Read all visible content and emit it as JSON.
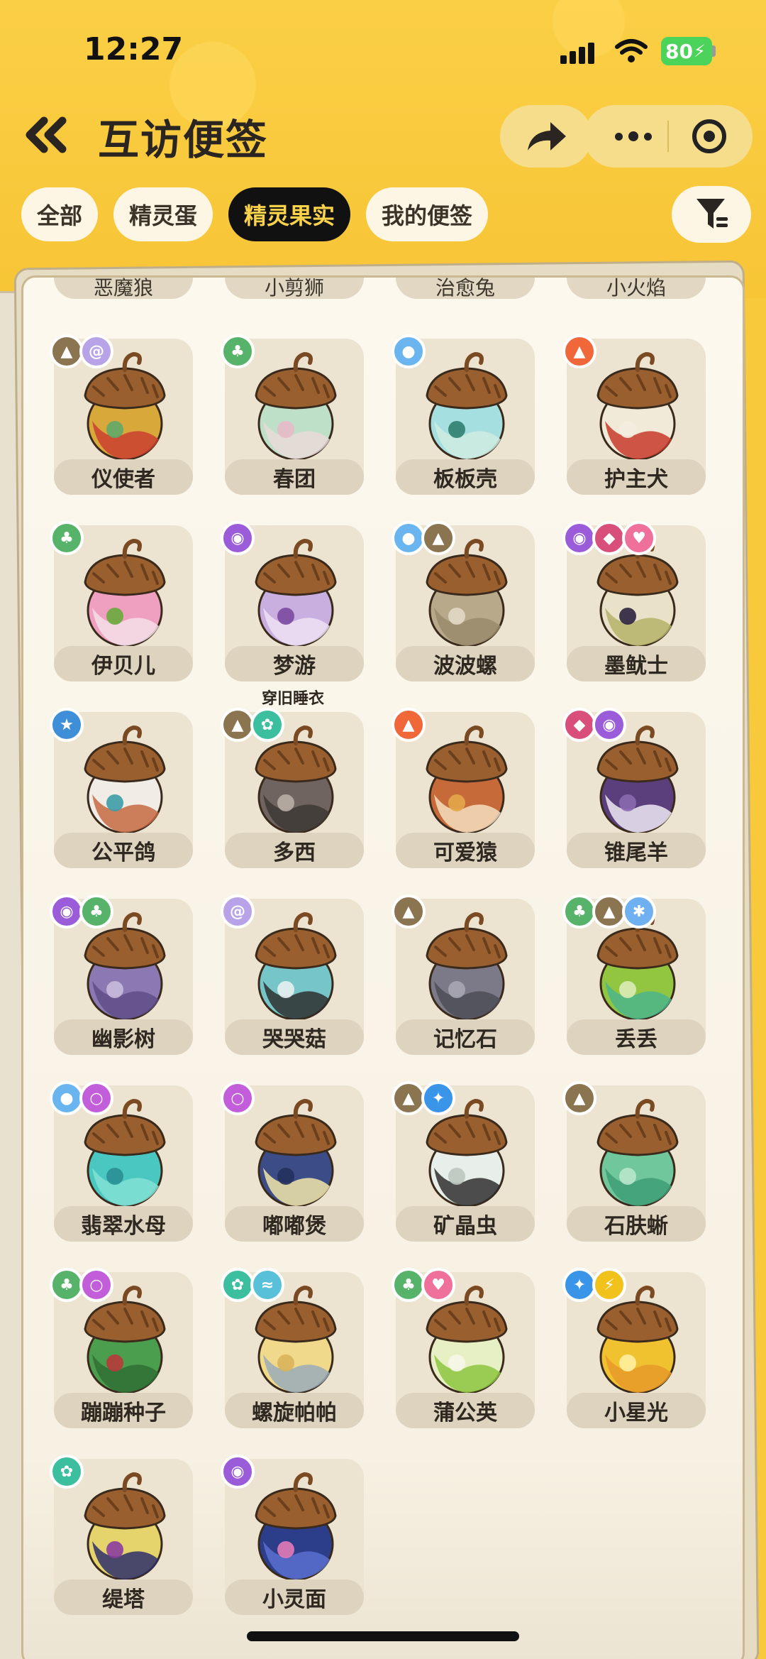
{
  "status": {
    "time": "12:27",
    "battery": "80"
  },
  "header": {
    "title": "互访便签"
  },
  "tabs": [
    {
      "label": "全部",
      "active": false
    },
    {
      "label": "精灵蛋",
      "active": false
    },
    {
      "label": "精灵果实",
      "active": true
    },
    {
      "label": "我的便签",
      "active": false
    }
  ],
  "cut_row": [
    "恶魔狼",
    "小剪狮",
    "治愈兔",
    "小火焰"
  ],
  "items": [
    {
      "name": "仪使者",
      "badges": [
        "mountain",
        "swirl"
      ],
      "colors": [
        "#d9a83a",
        "#c8402f",
        "#5fa86a"
      ]
    },
    {
      "name": "春团",
      "badges": [
        "leaf"
      ],
      "colors": [
        "#bfe0c8",
        "#e7d9d8",
        "#e7b9c7"
      ]
    },
    {
      "name": "板板壳",
      "badges": [
        "water"
      ],
      "colors": [
        "#a5dfe0",
        "#cfece0",
        "#2f7f6f"
      ]
    },
    {
      "name": "护主犬",
      "badges": [
        "fire"
      ],
      "colors": [
        "#f2ead8",
        "#c83a2c",
        "#f3ede0"
      ]
    },
    {
      "name": "伊贝儿",
      "badges": [
        "leaf"
      ],
      "colors": [
        "#ef9fc0",
        "#f4dfe8",
        "#6aaa3c"
      ]
    },
    {
      "name": "梦游",
      "badges": [
        "ghost"
      ],
      "colors": [
        "#c9aee0",
        "#efe2f4",
        "#7b4a9e"
      ]
    },
    {
      "name": "波波螺",
      "badges": [
        "water",
        "mountain"
      ],
      "colors": [
        "#b7a98a",
        "#9a8b6c",
        "#e2d8c4"
      ]
    },
    {
      "name": "墨鱿士",
      "badges": [
        "ghost",
        "demon",
        "heart"
      ],
      "colors": [
        "#e9e2c8",
        "#b5b36a",
        "#2c2440"
      ]
    },
    {
      "name": "公平鸽",
      "badges": [
        "star"
      ],
      "colors": [
        "#f1ece6",
        "#c56a40",
        "#3c9da6"
      ]
    },
    {
      "name": "多西",
      "badges": [
        "mountain",
        "gear"
      ],
      "colors": [
        "#6f6460",
        "#3e3836",
        "#b9aea6"
      ]
    },
    {
      "name": "可爱猿",
      "badges": [
        "fire"
      ],
      "colors": [
        "#c76a3a",
        "#f5dec0",
        "#e3a74a"
      ]
    },
    {
      "name": "锥尾羊",
      "badges": [
        "demon",
        "ghost"
      ],
      "colors": [
        "#5a3f7c",
        "#f0e9f5",
        "#8b6ab0"
      ]
    },
    {
      "name": "幽影树",
      "badges": [
        "ghost",
        "leaf"
      ],
      "colors": [
        "#8a79b2",
        "#5e4e86",
        "#c6bbdc"
      ]
    },
    {
      "name": "哭哭菇",
      "badges": [
        "swirl"
      ],
      "colors": [
        "#76c6c9",
        "#2f2f2f",
        "#e8f0f0"
      ]
    },
    {
      "name": "记忆石",
      "badges": [
        "mountain"
      ],
      "colors": [
        "#7c7a88",
        "#4e4d58",
        "#a8a6b4"
      ]
    },
    {
      "name": "丢丢",
      "badges": [
        "leaf",
        "mountain",
        "ice"
      ],
      "colors": [
        "#93c640",
        "#4bb58a",
        "#dcebb8"
      ]
    },
    {
      "name": "翡翠水母",
      "badges": [
        "water",
        "bubble"
      ],
      "colors": [
        "#4bc7c2",
        "#82e0d5",
        "#2a8f95"
      ]
    },
    {
      "name": "嘟嘟煲",
      "badges": [
        "bubble"
      ],
      "colors": [
        "#3b4c86",
        "#f1e6a8",
        "#24315e"
      ]
    },
    {
      "name": "矿晶虫",
      "badges": [
        "mountain",
        "crystal"
      ],
      "colors": [
        "#e8eee9",
        "#2f2f2f",
        "#bcc7bf"
      ]
    },
    {
      "name": "石肤蜥",
      "badges": [
        "mountain"
      ],
      "colors": [
        "#6fc79b",
        "#3f9e76",
        "#b8e6cc"
      ]
    },
    {
      "name": "蹦蹦种子",
      "badges": [
        "leaf",
        "bubble"
      ],
      "colors": [
        "#4a9e4e",
        "#2f6f34",
        "#b83a3a"
      ]
    },
    {
      "name": "螺旋帕帕",
      "badges": [
        "gear",
        "wing"
      ],
      "colors": [
        "#f0d98a",
        "#9aaab8",
        "#d9b35a"
      ]
    },
    {
      "name": "蒲公英",
      "badges": [
        "leaf",
        "heart"
      ],
      "colors": [
        "#e7efc4",
        "#8cc43f",
        "#f7f6ea"
      ]
    },
    {
      "name": "小星光",
      "badges": [
        "crystal",
        "bolt"
      ],
      "colors": [
        "#f1c22f",
        "#e79a2a",
        "#fff0a0"
      ]
    },
    {
      "name": "缇塔",
      "badges": [
        "gear"
      ],
      "colors": [
        "#e5d46b",
        "#2f2f6a",
        "#8a3ca0"
      ]
    },
    {
      "name": "小灵面",
      "badges": [
        "ghost"
      ],
      "colors": [
        "#2c3e8a",
        "#5a6fcf",
        "#e27ab6"
      ]
    }
  ],
  "extra_label": "穿旧睡衣",
  "badge_colors": {
    "mountain": "#8a7550",
    "swirl": "#b9a3e8",
    "leaf": "#57b36a",
    "water": "#6ab5f0",
    "fire": "#f0683a",
    "ghost": "#9b5cd9",
    "demon": "#d94f7c",
    "heart": "#f0709c",
    "star": "#3f8fd8",
    "gear": "#3bbf9f",
    "ice": "#6fb0f0",
    "bubble": "#c25ed9",
    "crystal": "#3a94e8",
    "wing": "#58c0d8",
    "bolt": "#f2c21c"
  }
}
